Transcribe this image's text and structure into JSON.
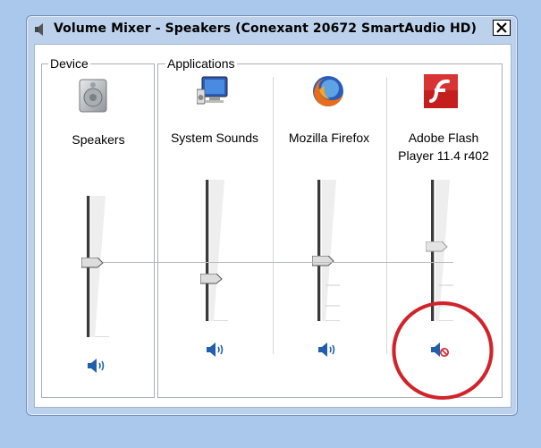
{
  "window": {
    "title": "Volume Mixer - Speakers (Conexant 20672 SmartAudio HD)"
  },
  "groups": {
    "device_label": "Device",
    "applications_label": "Applications"
  },
  "device": {
    "name": "Speakers",
    "volume_percent": 52,
    "muted": false,
    "icon": "speaker-device-icon"
  },
  "applications": [
    {
      "name": "System Sounds",
      "volume_percent": 30,
      "muted": false,
      "icon": "monitor-speaker-icon"
    },
    {
      "name": "Mozilla Firefox",
      "volume_percent": 42,
      "muted": false,
      "icon": "firefox-icon"
    },
    {
      "name_line1": "Adobe Flash",
      "name_line2": "Player 11.4 r402",
      "volume_percent": 52,
      "muted": true,
      "icon": "flash-player-icon"
    }
  ],
  "colors": {
    "window_frame": "#bcd2ec",
    "desktop": "#a9c8ec",
    "speaker_blue": "#1f5fae",
    "mute_red": "#d0242a",
    "annotation_circle": "#d0242a"
  }
}
